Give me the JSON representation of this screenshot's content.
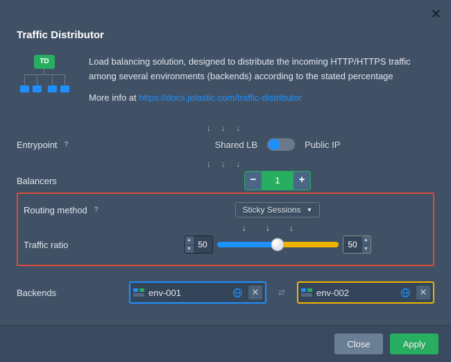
{
  "title": "Traffic Distributor",
  "icon_label": "TD",
  "description": {
    "text": "Load balancing solution, designed to distribute the incoming HTTP/HTTPS traffic among several environments (backends) according to the stated percentage",
    "more_prefix": "More info at ",
    "more_link": "https://docs.jelastic.com/traffic-distributor"
  },
  "entrypoint": {
    "label": "Entrypoint",
    "option_left": "Shared LB",
    "option_right": "Public IP"
  },
  "balancers": {
    "label": "Balancers",
    "value": "1"
  },
  "routing": {
    "label": "Routing method",
    "value": "Sticky Sessions"
  },
  "ratio": {
    "label": "Traffic ratio",
    "left": "50",
    "right": "50",
    "percent_left": 50
  },
  "backends": {
    "label": "Backends",
    "left": "env-001",
    "right": "env-002"
  },
  "buttons": {
    "close": "Close",
    "apply": "Apply"
  }
}
